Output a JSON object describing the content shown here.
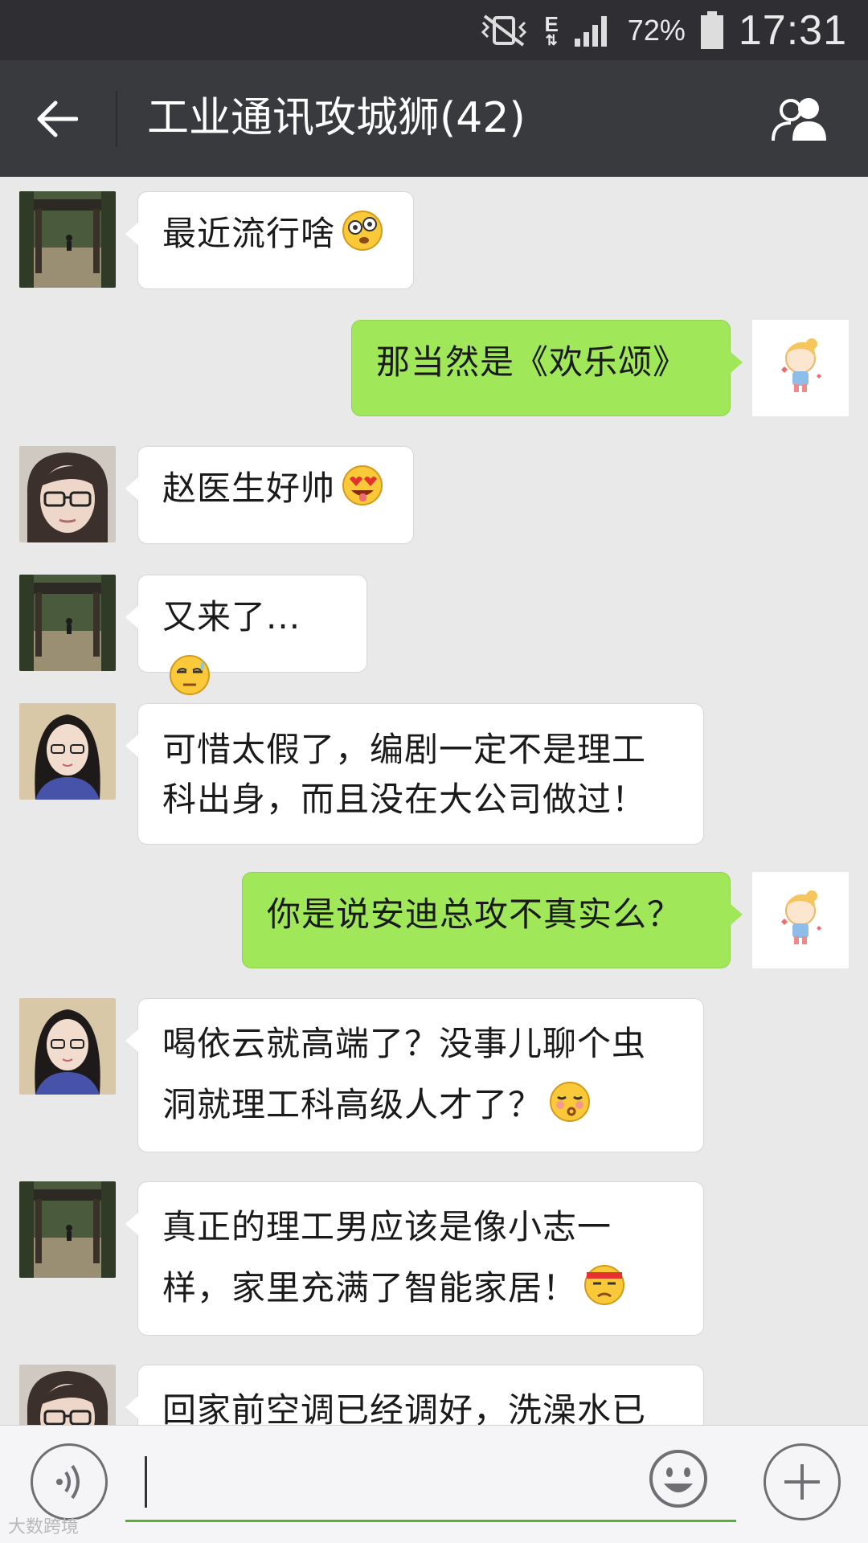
{
  "status_bar": {
    "network": "E",
    "battery": "72%",
    "time": "17:31"
  },
  "header": {
    "title": "工业通讯攻城狮(42)",
    "back_icon": "arrow-left-icon",
    "members_icon": "group-members-icon"
  },
  "messages": [
    {
      "side": "in",
      "avatar": "gate-photo-avatar",
      "text": "最近流行啥",
      "emoji": "dizzy-face-emoji"
    },
    {
      "side": "out",
      "avatar": "cartoon-girl-avatar",
      "text": "那当然是《欢乐颂》"
    },
    {
      "side": "in",
      "avatar": "glasses-woman-avatar",
      "text": "赵医生好帅",
      "emoji": "heart-eyes-emoji"
    },
    {
      "side": "in",
      "avatar": "gate-photo-avatar",
      "text": "又来了...",
      "emoji": "sweat-face-emoji"
    },
    {
      "side": "in",
      "avatar": "long-hair-woman-avatar",
      "line1": "可惜太假了，编剧一定不是理工",
      "line2": "科出身，而且没在大公司做过！"
    },
    {
      "side": "out",
      "avatar": "cartoon-girl-avatar",
      "text": "你是说安迪总攻不真实么？"
    },
    {
      "side": "in",
      "avatar": "long-hair-woman-avatar",
      "line1": "喝依云就高端了？没事儿聊个虫",
      "line2": "洞就理工科高级人才了？",
      "emoji": "whistle-face-emoji"
    },
    {
      "side": "in",
      "avatar": "gate-photo-avatar",
      "line1": "真正的理工男应该是像小志一",
      "line2": "样，家里充满了智能家居！",
      "emoji": "headband-face-emoji"
    },
    {
      "side": "in",
      "avatar": "glasses-woman-avatar",
      "line1": "回家前空调已经调好，洗澡水已"
    }
  ],
  "input_bar": {
    "voice_icon": "voice-icon",
    "emoji_icon": "smiley-icon",
    "plus_icon": "plus-icon",
    "input_value": ""
  },
  "watermark": "大数跨境",
  "colors": {
    "title_bar": "#393a3e",
    "status_bar": "#2f2f33",
    "chat_bg": "#e9e9ea",
    "bubble_out": "#a0e75a",
    "bubble_in": "#ffffff",
    "input_underline": "#56b036"
  }
}
